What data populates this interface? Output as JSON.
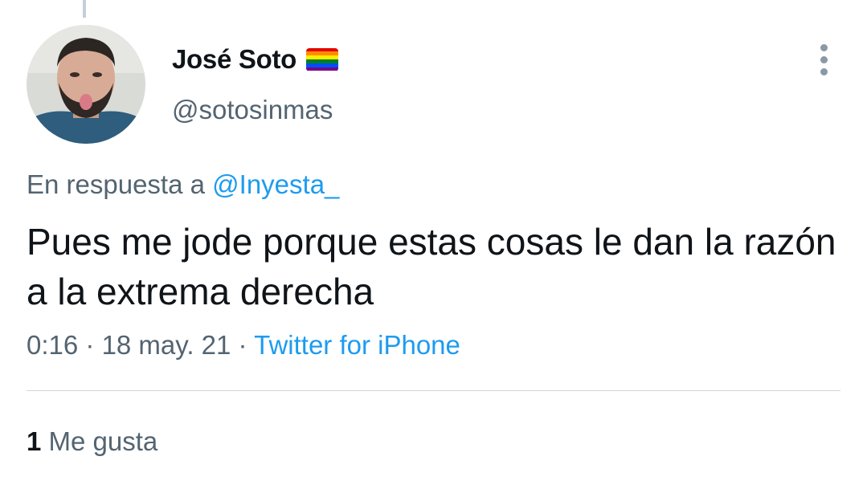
{
  "author": {
    "display_name": "José Soto",
    "handle": "@sotosinmas",
    "badge_icon": "rainbow-flag-icon",
    "badge_colors": [
      "#e40303",
      "#ff8c00",
      "#ffed00",
      "#008026",
      "#004dff",
      "#750787"
    ]
  },
  "menu_icon": "more-vertical-icon",
  "reply": {
    "prefix": "En respuesta a",
    "mention": "@Inyesta_"
  },
  "tweet": {
    "text": "Pues me jode porque estas cosas le dan la razón a la extrema derecha"
  },
  "meta": {
    "time": "0:16",
    "sep1": " · ",
    "date": "18 may. 21",
    "sep2": " · ",
    "source": "Twitter for iPhone"
  },
  "stats": {
    "likes_count": "1",
    "likes_label": "Me gusta"
  },
  "colors": {
    "link": "#1d9bf0",
    "text": "#0f1419",
    "secondary": "#536471"
  }
}
